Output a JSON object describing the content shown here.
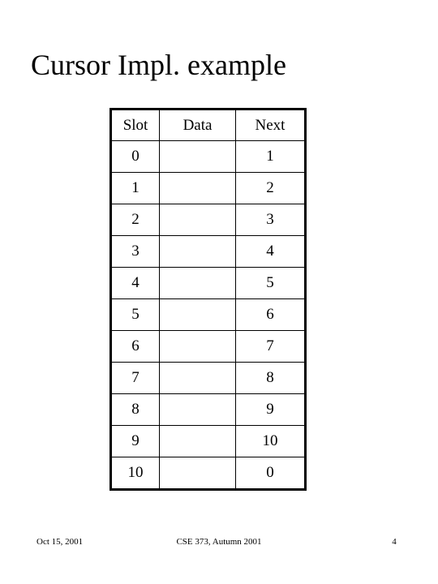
{
  "slide": {
    "title": "Cursor Impl. example",
    "background_color": "#ffffff",
    "text_color": "#000000"
  },
  "table": {
    "columns": [
      "Slot",
      "Data",
      "Next"
    ],
    "rows": [
      {
        "slot": "0",
        "data": "",
        "next": "1"
      },
      {
        "slot": "1",
        "data": "",
        "next": "2"
      },
      {
        "slot": "2",
        "data": "",
        "next": "3"
      },
      {
        "slot": "3",
        "data": "",
        "next": "4"
      },
      {
        "slot": "4",
        "data": "",
        "next": "5"
      },
      {
        "slot": "5",
        "data": "",
        "next": "6"
      },
      {
        "slot": "6",
        "data": "",
        "next": "7"
      },
      {
        "slot": "7",
        "data": "",
        "next": "8"
      },
      {
        "slot": "8",
        "data": "",
        "next": "9"
      },
      {
        "slot": "9",
        "data": "",
        "next": "10"
      },
      {
        "slot": "10",
        "data": "",
        "next": "0"
      }
    ]
  },
  "footer": {
    "date": "Oct 15, 2001",
    "course": "CSE 373, Autumn 2001",
    "page_number": "4"
  }
}
